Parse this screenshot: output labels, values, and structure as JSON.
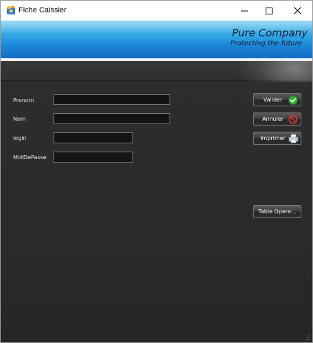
{
  "window": {
    "title": "Fiche Caissier",
    "controls": {
      "minimize": "minimize-icon",
      "maximize": "maximize-icon",
      "close": "close-icon"
    }
  },
  "banner": {
    "company": "Pure Company",
    "tagline": "Protecting the future"
  },
  "form": {
    "fields": [
      {
        "label": "Prenom",
        "value": ""
      },
      {
        "label": "Nom",
        "value": ""
      },
      {
        "label": "login",
        "value": ""
      },
      {
        "label": "MotDePasse",
        "value": ""
      }
    ]
  },
  "actions": {
    "valider": {
      "label": "Valider",
      "icon": "green-check-icon"
    },
    "annuler": {
      "label": "Annuler",
      "icon": "red-cancel-icon"
    },
    "imprimer": {
      "label": "Imprimer",
      "icon": "printer-icon"
    },
    "table_operations": {
      "label": "Table Opera..."
    }
  },
  "colors": {
    "banner_blue": "#1d8fdb",
    "body_dark": "#2c2c2c",
    "input_bg": "#141414",
    "accent_green": "#2eaa2e",
    "accent_red": "#d8322f"
  }
}
